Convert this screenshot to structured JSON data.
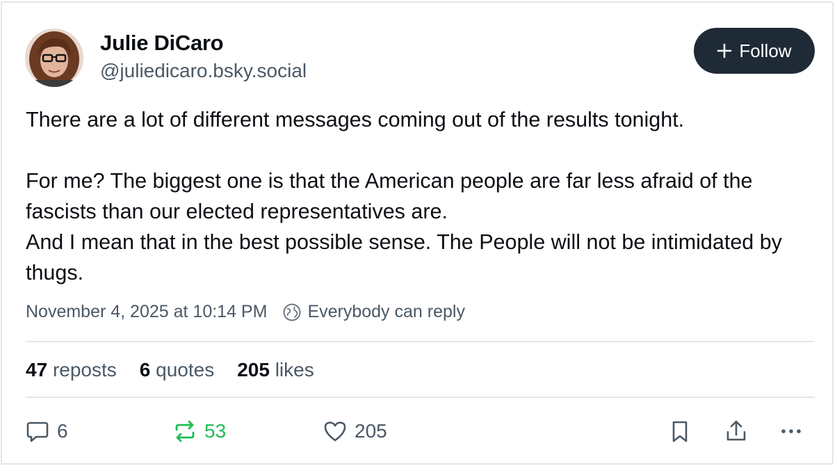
{
  "author": {
    "name": "Julie DiCaro",
    "handle": "@juliedicaro.bsky.social"
  },
  "follow_button": {
    "label": "Follow",
    "icon": "plus-icon"
  },
  "post": {
    "paragraph_1": "There are a lot of different messages coming out of the results tonight.",
    "paragraph_2": "For me? The biggest one is that the American people are far less afraid of the fascists than our elected representatives are.\nAnd I mean that in the best possible sense. The People will not be intimidated by thugs."
  },
  "meta": {
    "timestamp": "November 4, 2025 at 10:14 PM",
    "reply_setting": "Everybody can reply"
  },
  "stats": {
    "reposts_count": "47",
    "reposts_label": "reposts",
    "quotes_count": "6",
    "quotes_label": "quotes",
    "likes_count": "205",
    "likes_label": "likes"
  },
  "actions": {
    "reply_count": "6",
    "repost_count": "53",
    "like_count": "205"
  },
  "colors": {
    "follow_bg": "#1f2a37",
    "repost_active": "#20bc56",
    "muted_text": "#4b5866",
    "divider": "#e3e6ea"
  }
}
